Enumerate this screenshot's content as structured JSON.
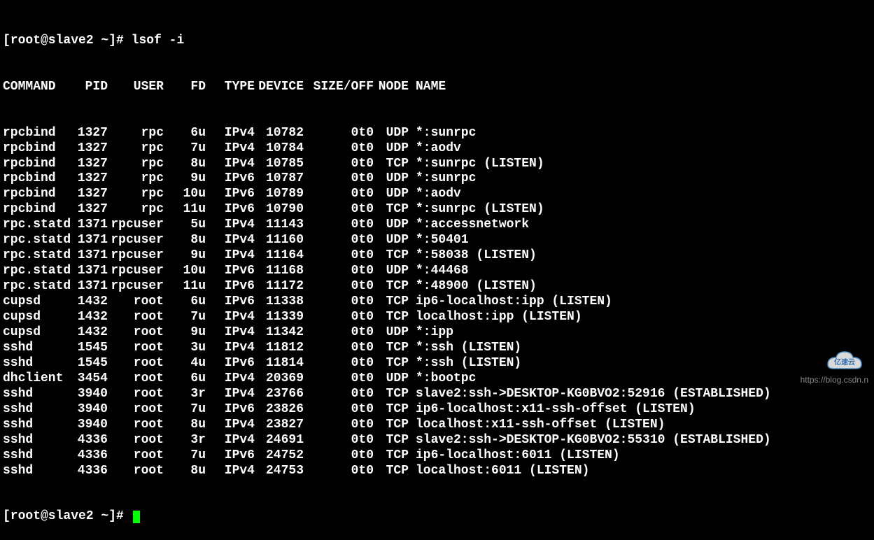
{
  "prompt": "[root@slave2 ~]# ",
  "command": "lsof -i",
  "headers": {
    "command": "COMMAND",
    "pid": "PID",
    "user": "USER",
    "fd": "FD",
    "type": "TYPE",
    "device": "DEVICE",
    "sizeoff": "SIZE/OFF",
    "node": "NODE",
    "name": "NAME"
  },
  "rows": [
    {
      "command": "rpcbind",
      "pid": "1327",
      "user": "rpc",
      "fd": "6u",
      "type": "IPv4",
      "device": "10782",
      "sizeoff": "0t0",
      "node": "UDP",
      "name": "*:sunrpc"
    },
    {
      "command": "rpcbind",
      "pid": "1327",
      "user": "rpc",
      "fd": "7u",
      "type": "IPv4",
      "device": "10784",
      "sizeoff": "0t0",
      "node": "UDP",
      "name": "*:aodv"
    },
    {
      "command": "rpcbind",
      "pid": "1327",
      "user": "rpc",
      "fd": "8u",
      "type": "IPv4",
      "device": "10785",
      "sizeoff": "0t0",
      "node": "TCP",
      "name": "*:sunrpc (LISTEN)"
    },
    {
      "command": "rpcbind",
      "pid": "1327",
      "user": "rpc",
      "fd": "9u",
      "type": "IPv6",
      "device": "10787",
      "sizeoff": "0t0",
      "node": "UDP",
      "name": "*:sunrpc"
    },
    {
      "command": "rpcbind",
      "pid": "1327",
      "user": "rpc",
      "fd": "10u",
      "type": "IPv6",
      "device": "10789",
      "sizeoff": "0t0",
      "node": "UDP",
      "name": "*:aodv"
    },
    {
      "command": "rpcbind",
      "pid": "1327",
      "user": "rpc",
      "fd": "11u",
      "type": "IPv6",
      "device": "10790",
      "sizeoff": "0t0",
      "node": "TCP",
      "name": "*:sunrpc (LISTEN)"
    },
    {
      "command": "rpc.statd",
      "pid": "1371",
      "user": "rpcuser",
      "fd": "5u",
      "type": "IPv4",
      "device": "11143",
      "sizeoff": "0t0",
      "node": "UDP",
      "name": "*:accessnetwork"
    },
    {
      "command": "rpc.statd",
      "pid": "1371",
      "user": "rpcuser",
      "fd": "8u",
      "type": "IPv4",
      "device": "11160",
      "sizeoff": "0t0",
      "node": "UDP",
      "name": "*:50401"
    },
    {
      "command": "rpc.statd",
      "pid": "1371",
      "user": "rpcuser",
      "fd": "9u",
      "type": "IPv4",
      "device": "11164",
      "sizeoff": "0t0",
      "node": "TCP",
      "name": "*:58038 (LISTEN)"
    },
    {
      "command": "rpc.statd",
      "pid": "1371",
      "user": "rpcuser",
      "fd": "10u",
      "type": "IPv6",
      "device": "11168",
      "sizeoff": "0t0",
      "node": "UDP",
      "name": "*:44468"
    },
    {
      "command": "rpc.statd",
      "pid": "1371",
      "user": "rpcuser",
      "fd": "11u",
      "type": "IPv6",
      "device": "11172",
      "sizeoff": "0t0",
      "node": "TCP",
      "name": "*:48900 (LISTEN)"
    },
    {
      "command": "cupsd",
      "pid": "1432",
      "user": "root",
      "fd": "6u",
      "type": "IPv6",
      "device": "11338",
      "sizeoff": "0t0",
      "node": "TCP",
      "name": "ip6-localhost:ipp (LISTEN)"
    },
    {
      "command": "cupsd",
      "pid": "1432",
      "user": "root",
      "fd": "7u",
      "type": "IPv4",
      "device": "11339",
      "sizeoff": "0t0",
      "node": "TCP",
      "name": "localhost:ipp (LISTEN)"
    },
    {
      "command": "cupsd",
      "pid": "1432",
      "user": "root",
      "fd": "9u",
      "type": "IPv4",
      "device": "11342",
      "sizeoff": "0t0",
      "node": "UDP",
      "name": "*:ipp"
    },
    {
      "command": "sshd",
      "pid": "1545",
      "user": "root",
      "fd": "3u",
      "type": "IPv4",
      "device": "11812",
      "sizeoff": "0t0",
      "node": "TCP",
      "name": "*:ssh (LISTEN)"
    },
    {
      "command": "sshd",
      "pid": "1545",
      "user": "root",
      "fd": "4u",
      "type": "IPv6",
      "device": "11814",
      "sizeoff": "0t0",
      "node": "TCP",
      "name": "*:ssh (LISTEN)"
    },
    {
      "command": "dhclient",
      "pid": "3454",
      "user": "root",
      "fd": "6u",
      "type": "IPv4",
      "device": "20369",
      "sizeoff": "0t0",
      "node": "UDP",
      "name": "*:bootpc"
    },
    {
      "command": "sshd",
      "pid": "3940",
      "user": "root",
      "fd": "3r",
      "type": "IPv4",
      "device": "23766",
      "sizeoff": "0t0",
      "node": "TCP",
      "name": "slave2:ssh->DESKTOP-KG0BVO2:52916 (ESTABLISHED)"
    },
    {
      "command": "sshd",
      "pid": "3940",
      "user": "root",
      "fd": "7u",
      "type": "IPv6",
      "device": "23826",
      "sizeoff": "0t0",
      "node": "TCP",
      "name": "ip6-localhost:x11-ssh-offset (LISTEN)"
    },
    {
      "command": "sshd",
      "pid": "3940",
      "user": "root",
      "fd": "8u",
      "type": "IPv4",
      "device": "23827",
      "sizeoff": "0t0",
      "node": "TCP",
      "name": "localhost:x11-ssh-offset (LISTEN)"
    },
    {
      "command": "sshd",
      "pid": "4336",
      "user": "root",
      "fd": "3r",
      "type": "IPv4",
      "device": "24691",
      "sizeoff": "0t0",
      "node": "TCP",
      "name": "slave2:ssh->DESKTOP-KG0BVO2:55310 (ESTABLISHED)"
    },
    {
      "command": "sshd",
      "pid": "4336",
      "user": "root",
      "fd": "7u",
      "type": "IPv6",
      "device": "24752",
      "sizeoff": "0t0",
      "node": "TCP",
      "name": "ip6-localhost:6011 (LISTEN)"
    },
    {
      "command": "sshd",
      "pid": "4336",
      "user": "root",
      "fd": "8u",
      "type": "IPv4",
      "device": "24753",
      "sizeoff": "0t0",
      "node": "TCP",
      "name": "localhost:6011 (LISTEN)"
    }
  ],
  "prompt2": "[root@slave2 ~]# ",
  "watermark": {
    "label": "亿速云",
    "url": "https://blog.csdn.n"
  }
}
